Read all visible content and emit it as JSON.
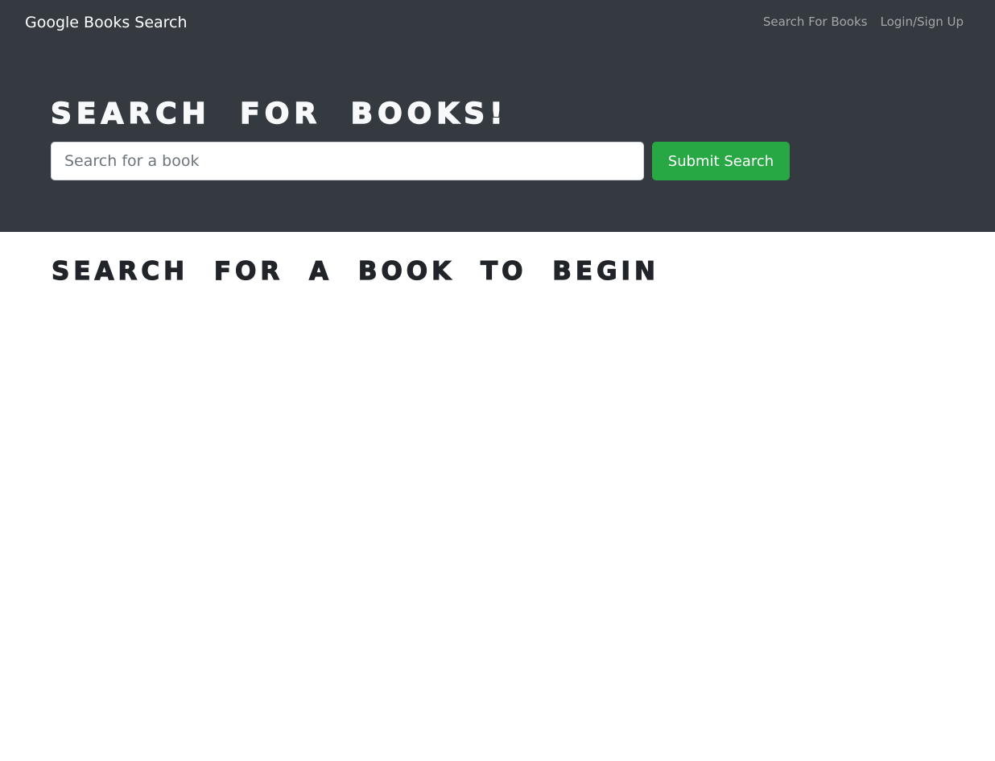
{
  "navbar": {
    "brand": "Google Books Search",
    "links": [
      {
        "label": "Search For Books"
      },
      {
        "label": "Login/Sign Up"
      }
    ]
  },
  "hero": {
    "title": "SEARCH FOR BOOKS!",
    "search": {
      "placeholder": "Search for a book",
      "value": ""
    },
    "submit_label": "Submit Search"
  },
  "results": {
    "heading": "SEARCH FOR A BOOK TO BEGIN"
  },
  "colors": {
    "navbar_bg": "#343a40",
    "submit_bg": "#28a745",
    "heading_text": "#212529"
  }
}
